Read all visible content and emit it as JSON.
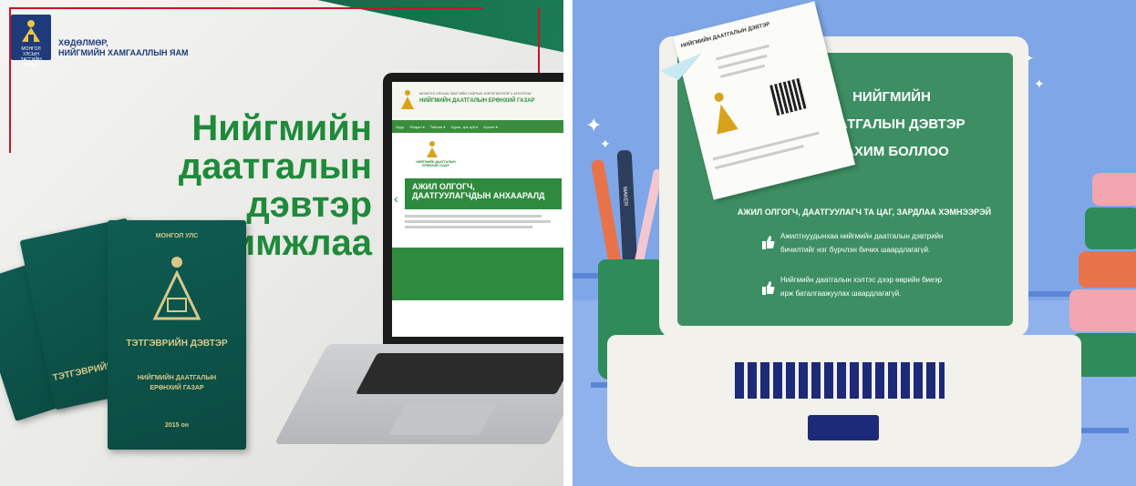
{
  "left_panel": {
    "logo": {
      "text": "МОНГОЛ УЛСЫН ЗАСГИЙН ГАЗАР",
      "icon": "soyombo-emblem-icon"
    },
    "ministry": {
      "line1": "ХӨДӨЛМӨР,",
      "line2": "НИЙГМИЙН ХАМГААЛЛЫН ЯАМ"
    },
    "headline": {
      "line1": "Нийгмийн даатгалын",
      "line2": "дэвтэр цахимжлаа"
    },
    "passport": {
      "country": "МОНГОЛ УЛС",
      "title": "ТЭТГЭВРИЙН ДЭВТЭР",
      "agency_line1": "НИЙГМИЙН ДААТГАЛЫН",
      "agency_line2": "ЕРӨНХИЙ ГАЗАР",
      "year": "2015 он"
    },
    "website": {
      "header_small": "МОНГОЛ УЛСЫН ЗАСГИЙН ГАЗРЫН ХЭРЭГЖҮҮЛЭГЧ АГЕНТЛАГ",
      "header_title": "НИЙГМИЙН ДААТГАЛЫН ЕРӨНХИЙ ГАЗАР",
      "nav": [
        "Нүүр",
        "Үйлдэл ▾",
        "Тайлан ▾",
        "Хууль, эрх зүй ▾",
        "Хүсэлт ▾"
      ],
      "banner_logo_text": "НИЙГМИЙН ДААТГАЛЫН ЕРӨНХИЙ ГАЗАР",
      "banner_line1": "АЖИЛ ОЛГОГЧ,",
      "banner_line2": "ДААТГУУЛАГЧДЫН АНХААРАЛД"
    }
  },
  "right_panel": {
    "card": {
      "title": "НИЙГМИЙН ДААТГАЛЫН ДЭВТЭР"
    },
    "screen_title": {
      "line1": "НИЙГМИЙН",
      "line2": "ДААТГАЛЫН ДЭВТЭР",
      "line3": "ЦАХИМ БОЛЛОО"
    },
    "subtitle": "АЖИЛ ОЛГОГЧ, ДААТГУУЛАГЧ ТА ЦАГ, ЗАРДЛАА ХЭМНЭЭРЭЙ",
    "bullets": [
      {
        "line1": "Ажилтнуудынхаа нийгмийн даатгалын дэвтрийн",
        "line2": "бичилтийг нэг бүрчлэн бичих шаардлагагүй."
      },
      {
        "line1": "Нийгмийн даатгалын хэлтэс дээр өөрийн биеэр",
        "line2": "ирж баталгаажуулах шаардлагагүй."
      }
    ],
    "marker_text": "MAKER"
  }
}
